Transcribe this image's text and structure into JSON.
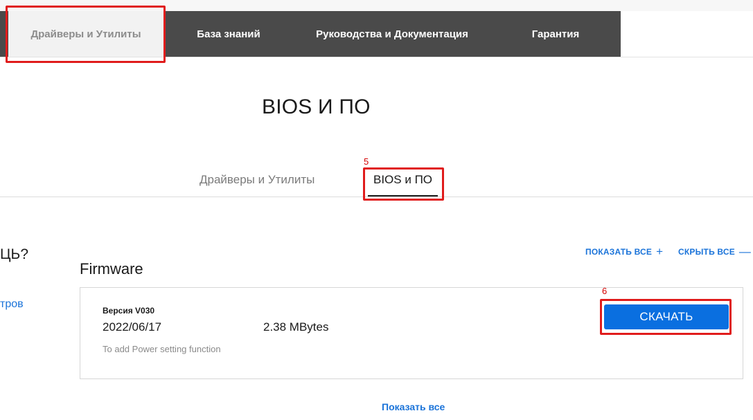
{
  "nav": {
    "tabs": [
      {
        "label": "Драйверы и Утилиты"
      },
      {
        "label": "База знаний"
      },
      {
        "label": "Руководства и Документация"
      },
      {
        "label": "Гарантия"
      }
    ]
  },
  "page": {
    "title": "BIOS И ПО"
  },
  "subtabs": [
    {
      "label": "Драйверы и Утилиты"
    },
    {
      "label": "BIOS и ПО"
    }
  ],
  "sidebar": {
    "question": "ЦЬ?",
    "link": "тров"
  },
  "controls": {
    "expand_all": "ПОКАЗАТЬ ВСЕ",
    "expand_icon": "+",
    "collapse_all": "СКРЫТЬ ВСЕ",
    "collapse_icon": "—"
  },
  "section": {
    "title": "Firmware"
  },
  "item": {
    "version": "Версия V030",
    "date": "2022/06/17",
    "size": "2.38 MBytes",
    "description": "To add Power setting function",
    "download_label": "СКАЧАТЬ"
  },
  "footer": {
    "show_all": "Показать все"
  },
  "annotations": {
    "marker_5": "5",
    "marker_6": "6"
  },
  "colors": {
    "accent": "#0a6fe0",
    "link": "#1a73d9",
    "nav_bg": "#4a4a4a",
    "highlight": "#e01c1c"
  }
}
